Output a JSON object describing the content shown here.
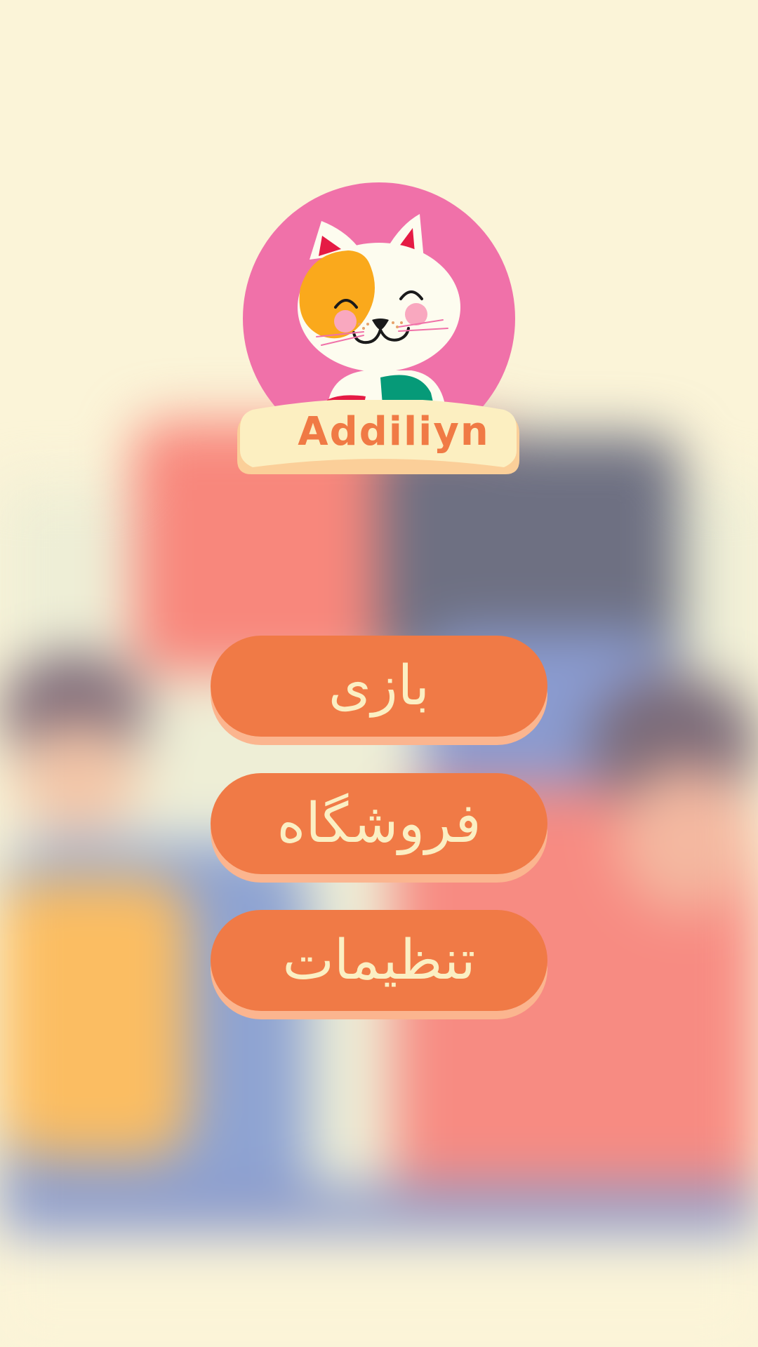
{
  "app": {
    "name": "Addiliyn"
  },
  "menu": {
    "items": [
      {
        "label": "بازی"
      },
      {
        "label": "فروشگاه"
      },
      {
        "label": "تنظیمات"
      }
    ]
  },
  "colors": {
    "background": "#fbf4d8",
    "button_fill": "#f07a46",
    "button_shadow": "#fbb58f",
    "button_text": "#fbefc3",
    "logo_circle": "#f071a9",
    "name_text": "#f07a45",
    "name_plate": "#fcefc1"
  },
  "icons": {
    "logo": "cat-face-icon"
  }
}
